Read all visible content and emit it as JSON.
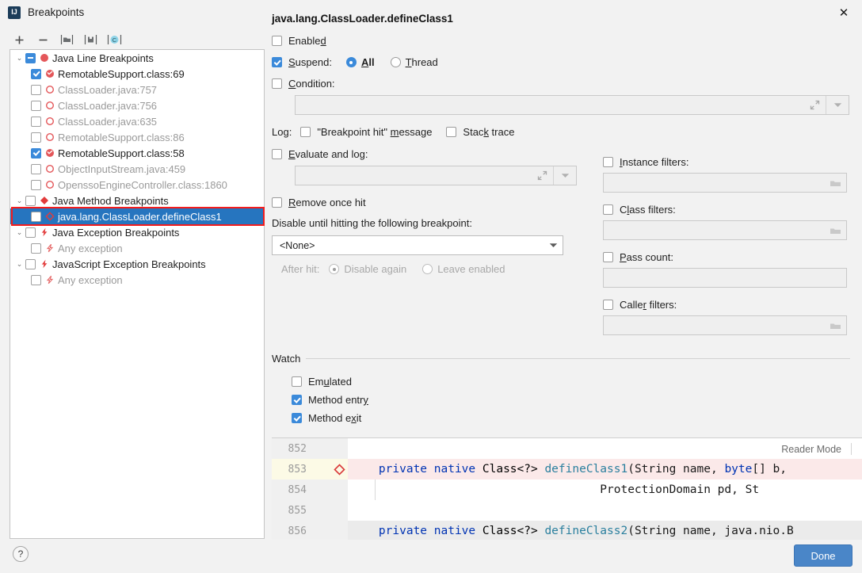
{
  "window": {
    "title": "Breakpoints",
    "app_icon": "intellij-idea-icon",
    "close_label": "✕"
  },
  "toolbar": {
    "add_label": "+",
    "remove_label": "−",
    "group_label": "[▣]",
    "export_label": "[▤]",
    "muted_label": "[C]"
  },
  "tree": {
    "groups": [
      {
        "label": "Java Line Breakpoints",
        "twisty": "⌄",
        "check_state": "partial",
        "icon": "red-circle-breakpoint-icon",
        "children": [
          {
            "label": "RemotableSupport.class:69",
            "checked": true,
            "muted": false,
            "icon": "breakpoint-verified-icon"
          },
          {
            "label": "ClassLoader.java:757",
            "checked": false,
            "muted": true,
            "icon": "breakpoint-disabled-icon"
          },
          {
            "label": "ClassLoader.java:756",
            "checked": false,
            "muted": true,
            "icon": "breakpoint-disabled-icon"
          },
          {
            "label": "ClassLoader.java:635",
            "checked": false,
            "muted": true,
            "icon": "breakpoint-disabled-icon"
          },
          {
            "label": "RemotableSupport.class:86",
            "checked": false,
            "muted": true,
            "icon": "breakpoint-disabled-icon"
          },
          {
            "label": "RemotableSupport.class:58",
            "checked": true,
            "muted": false,
            "icon": "breakpoint-verified-icon"
          },
          {
            "label": "ObjectInputStream.java:459",
            "checked": false,
            "muted": true,
            "icon": "breakpoint-disabled-icon"
          },
          {
            "label": "OpenssoEngineController.class:1860",
            "checked": false,
            "muted": true,
            "icon": "breakpoint-disabled-icon"
          }
        ]
      },
      {
        "label": "Java Method Breakpoints",
        "twisty": "⌄",
        "check_state": "unchecked",
        "icon": "red-diamond-breakpoint-icon",
        "children": [
          {
            "label": "java.lang.ClassLoader.defineClass1",
            "checked": false,
            "muted": false,
            "selected": true,
            "icon": "method-breakpoint-disabled-icon"
          }
        ]
      },
      {
        "label": "Java Exception Breakpoints",
        "twisty": "⌄",
        "check_state": "unchecked",
        "icon": "red-lightning-breakpoint-icon",
        "children": [
          {
            "label": "Any exception",
            "checked": false,
            "muted": true,
            "icon": "exception-breakpoint-icon"
          }
        ]
      },
      {
        "label": "JavaScript Exception Breakpoints",
        "twisty": "⌄",
        "check_state": "unchecked",
        "icon": "red-lightning-breakpoint-icon",
        "children": [
          {
            "label": "Any exception",
            "checked": false,
            "muted": true,
            "icon": "exception-breakpoint-icon"
          }
        ]
      }
    ]
  },
  "detail": {
    "title": "java.lang.ClassLoader.defineClass1",
    "enabled": {
      "label": "Enabled",
      "checked": false
    },
    "suspend": {
      "label": "Suspend:",
      "checked": true,
      "options": [
        "All",
        "Thread"
      ],
      "selected": "All"
    },
    "condition": {
      "label": "Condition:",
      "checked": false,
      "value": "",
      "expand_icon": "expand-editor-icon",
      "dropdown_icon": "chevron-down-icon"
    },
    "log": {
      "label": "Log:",
      "breakpoint_hit": {
        "label": "\"Breakpoint hit\" message",
        "checked": false
      },
      "stack_trace": {
        "label": "Stack trace",
        "checked": false
      },
      "evaluate_and_log": {
        "label": "Evaluate and log:",
        "checked": false,
        "value": ""
      }
    },
    "remove_once_hit": {
      "label": "Remove once hit",
      "checked": false
    },
    "disable_until": {
      "label": "Disable until hitting the following breakpoint:",
      "selected": "<None>",
      "options": [
        "<None>"
      ]
    },
    "after_hit": {
      "label": "After hit:",
      "options": [
        "Disable again",
        "Leave enabled"
      ],
      "selected": "Disable again",
      "disabled": true
    },
    "filters": [
      {
        "label": "Instance filters:",
        "checked": false,
        "value": "",
        "has_browse": true
      },
      {
        "label": "Class filters:",
        "checked": false,
        "value": "",
        "has_browse": true
      },
      {
        "label": "Pass count:",
        "checked": false,
        "value": "",
        "has_browse": false
      },
      {
        "label": "Caller filters:",
        "checked": false,
        "value": "",
        "has_browse": true
      }
    ],
    "watch": {
      "title": "Watch",
      "items": [
        {
          "label": "Emulated",
          "checked": false
        },
        {
          "label": "Method entry",
          "checked": true
        },
        {
          "label": "Method exit",
          "checked": true
        }
      ]
    }
  },
  "code_preview": {
    "reader_mode_label": "Reader Mode",
    "lines": [
      {
        "number": "852",
        "highlight": "none",
        "tokens": []
      },
      {
        "number": "853",
        "highlight": "breakpoint",
        "gutter_icon": "method-breakpoint-diamond-icon",
        "tokens": [
          {
            "text": "    private native ",
            "cls": "kw"
          },
          {
            "text": "Class<?> ",
            "cls": "type"
          },
          {
            "text": "defineClass1",
            "cls": "mth"
          },
          {
            "text": "(String name, ",
            "cls": "plain"
          },
          {
            "text": "byte",
            "cls": "kw"
          },
          {
            "text": "[] b,",
            "cls": "plain"
          }
        ]
      },
      {
        "number": "854",
        "highlight": "none",
        "tokens": [
          {
            "text": "                                    ProtectionDomain pd, St",
            "cls": "plain"
          }
        ]
      },
      {
        "number": "855",
        "highlight": "none",
        "tokens": []
      },
      {
        "number": "856",
        "highlight": "gray",
        "tokens": [
          {
            "text": "    private native ",
            "cls": "kw"
          },
          {
            "text": "Class<?> ",
            "cls": "type"
          },
          {
            "text": "defineClass2",
            "cls": "mth"
          },
          {
            "text": "(String name, java.nio.B",
            "cls": "plain"
          }
        ]
      }
    ]
  },
  "footer": {
    "help_label": "?",
    "done_label": "Done"
  },
  "colors": {
    "accent": "#3b8ada",
    "selection": "#2675bf",
    "annotation": "#f51c1c",
    "breakpoint_red": "#e4575a",
    "done_button": "#4a86c8"
  }
}
